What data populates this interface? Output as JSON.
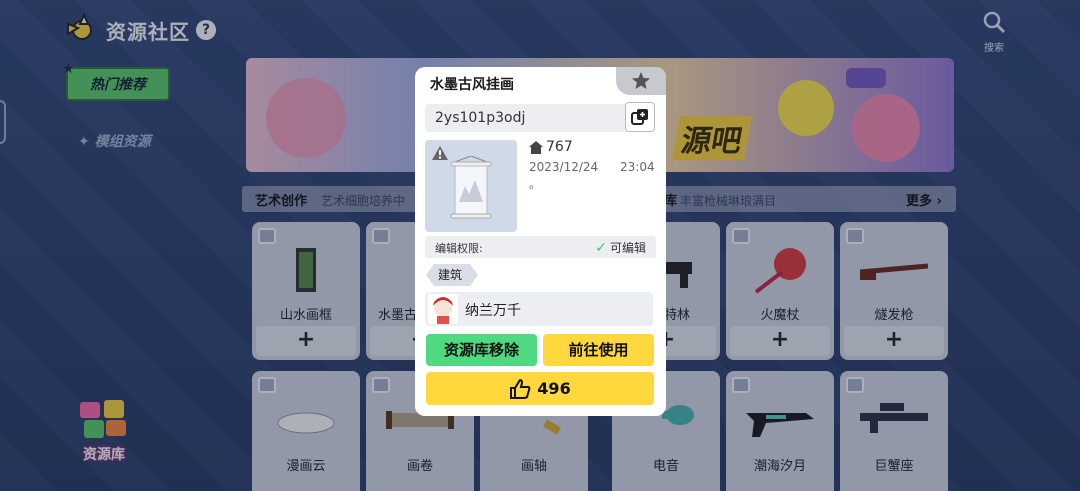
{
  "app": {
    "title": "资源社区",
    "help_icon": "?",
    "search_label": "搜索"
  },
  "sidebar": {
    "tabs": [
      {
        "label": "热门推荐",
        "active": true
      },
      {
        "label": "模组资源",
        "active": false
      }
    ],
    "resource_library_label": "资源库"
  },
  "banner": {
    "text": "源吧"
  },
  "section": {
    "title": "艺术创作",
    "subtitle": "艺术细胞培养中",
    "tab2": "库",
    "tab2_subtitle": "丰富枪械琳琅满目",
    "more_label": "更多"
  },
  "cards": [
    {
      "name": "山水画框",
      "add": "+"
    },
    {
      "name": "水墨古",
      "add": "+"
    },
    {
      "name": "",
      "add": "+"
    },
    {
      "name": "特林",
      "add": "+"
    },
    {
      "name": "火魔杖",
      "add": "+"
    },
    {
      "name": "燧发枪",
      "add": "+"
    },
    {
      "name": "漫画云"
    },
    {
      "name": "画卷"
    },
    {
      "name": "画轴"
    },
    {
      "name": "电音"
    },
    {
      "name": "潮海汐月"
    },
    {
      "name": "巨蟹座"
    }
  ],
  "modal": {
    "title": "水墨古风挂画",
    "code": "2ys101p3odj",
    "owner_count": "767",
    "date": "2023/12/24",
    "time": "23:04",
    "description": "。",
    "permission_label": "编辑权限:",
    "permission_value": "可编辑",
    "tag": "建筑",
    "author": "纳兰万千",
    "remove_button": "资源库移除",
    "use_button": "前往使用",
    "like_count": "496"
  },
  "colors": {
    "background": "#2c3f6a",
    "green_button": "#4fd981",
    "yellow_button": "#ffd83d",
    "active_tab": "#5fd06a"
  }
}
